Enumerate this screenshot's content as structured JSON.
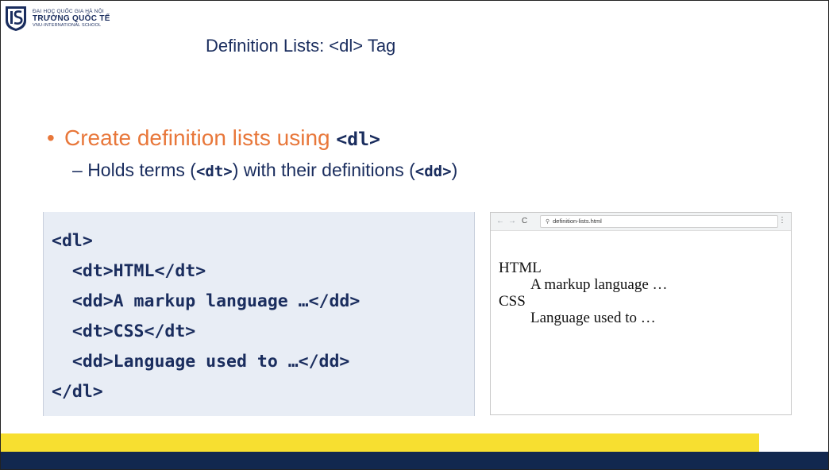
{
  "logo": {
    "line1": "ĐẠI HỌC QUỐC GIA HÀ NỘI",
    "line2": "TRƯỜNG QUỐC TẾ",
    "line3": "VNU-INTERNATIONAL SCHOOL",
    "mark": "IS"
  },
  "title": "Definition Lists: <dl> Tag",
  "bullet": {
    "text": "Create definition lists using ",
    "code": "<dl>"
  },
  "sub": {
    "dash": "– ",
    "t1": "Holds terms (",
    "c1": "<dt>",
    "t2": ") with their definitions (",
    "c2": "<dd>",
    "t3": ")"
  },
  "code_block": "<dl>\n  <dt>HTML</dt>\n  <dd>A markup language …</dd>\n  <dt>CSS</dt>\n  <dd>Language used to …</dd>\n</dl>",
  "browser": {
    "url": "definition-lists.html",
    "items": [
      {
        "term": "HTML",
        "def": "A markup language …"
      },
      {
        "term": "CSS",
        "def": "Language used to …"
      }
    ]
  },
  "colors": {
    "navy": "#12284f",
    "yellow": "#f7df30",
    "accent": "#e8773a",
    "code_bg": "#e8edf5"
  }
}
